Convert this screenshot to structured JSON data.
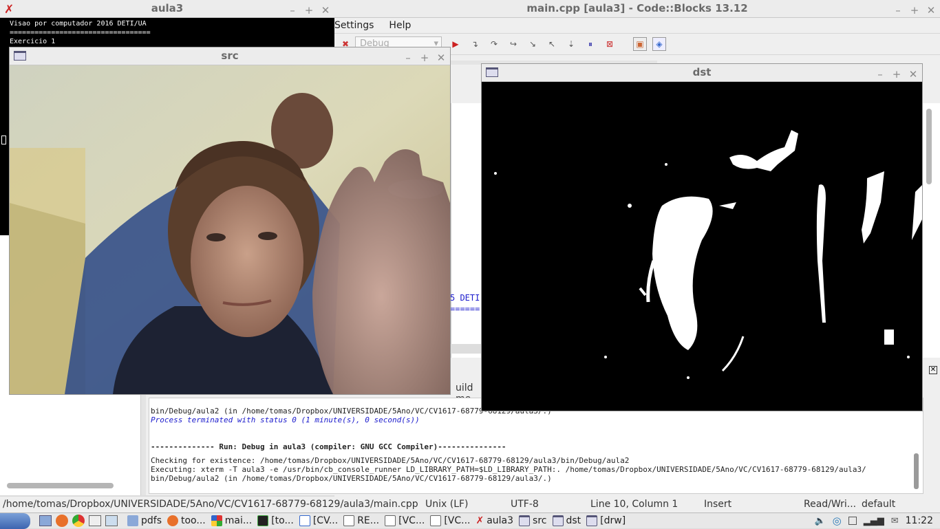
{
  "terminal": {
    "title": "aula3",
    "lines": [
      "Visao por computador 2016 DETI/UA",
      "==================================",
      "Exercicio 1"
    ]
  },
  "codeblocks": {
    "title": "main.cpp [aula3] - Code::Blocks 13.12",
    "menu": [
      "Settings",
      "Help"
    ],
    "build_target": "Debug",
    "editor_fragments": [
      "5 DETI",
      "======"
    ],
    "log_tab_label": "uild me",
    "log": {
      "l1": "bin/Debug/aula2  (in /home/tomas/Dropbox/UNIVERSIDADE/5Ano/VC/CV1617-68779-68129/aula3/.)",
      "l2": "Process terminated with status 0 (1 minute(s), 0 second(s))",
      "l3": "-------------- Run: Debug in aula3 (compiler: GNU GCC Compiler)---------------",
      "l4": "Checking for existence: /home/tomas/Dropbox/UNIVERSIDADE/5Ano/VC/CV1617-68779-68129/aula3/bin/Debug/aula2",
      "l5": "Executing: xterm -T aula3 -e /usr/bin/cb_console_runner LD_LIBRARY_PATH=$LD_LIBRARY_PATH:. /home/tomas/Dropbox/UNIVERSIDADE/5Ano/VC/CV1617-68779-68129/aula3/",
      "l6": "bin/Debug/aula2  (in /home/tomas/Dropbox/UNIVERSIDADE/5Ano/VC/CV1617-68779-68129/aula3/.)"
    },
    "status": {
      "path": "/home/tomas/Dropbox/UNIVERSIDADE/5Ano/VC/CV1617-68779-68129/aula3/main.cpp",
      "eol": "Unix (LF)",
      "encoding": "UTF-8",
      "position": "Line 10, Column 1",
      "mode": "Insert",
      "access": "Read/Wri...",
      "profile": "default"
    }
  },
  "src_window": {
    "title": "src"
  },
  "dst_window": {
    "title": "dst"
  },
  "taskbar": {
    "items": [
      {
        "label": "pdfs",
        "icon": "folder-icon"
      },
      {
        "label": "too...",
        "icon": "firefox-icon"
      },
      {
        "label": "mai...",
        "icon": "codeblocks-icon"
      },
      {
        "label": "[to...",
        "icon": "terminal-icon"
      },
      {
        "label": "[CV...",
        "icon": "code-icon"
      },
      {
        "label": "RE...",
        "icon": "document-icon"
      },
      {
        "label": "[VC...",
        "icon": "document-icon"
      },
      {
        "label": "[VC...",
        "icon": "document-icon"
      },
      {
        "label": "aula3",
        "icon": "xterm-icon"
      },
      {
        "label": "src",
        "icon": "window-icon"
      },
      {
        "label": "dst",
        "icon": "window-icon"
      },
      {
        "label": "[drw]",
        "icon": "window-icon"
      }
    ],
    "clock": "11:22"
  },
  "colors": {
    "log_blue": "#1a1acc",
    "taskbar_bg": "#e8e8e8",
    "terminal_bg": "#000000"
  }
}
